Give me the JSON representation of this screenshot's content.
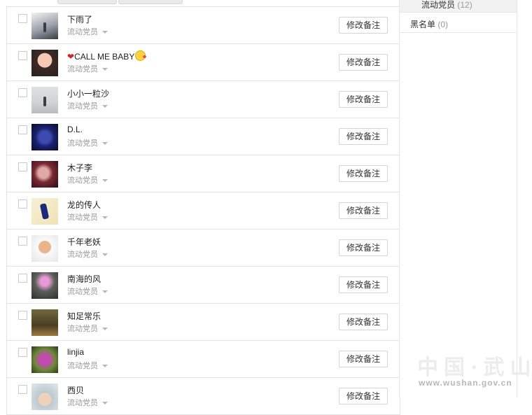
{
  "members": [
    {
      "name": "下雨了",
      "group": "流动党员",
      "action": "修改备注"
    },
    {
      "name_heart": "❤",
      "name": "CALL ME BABY",
      "name_emoji": "wink-kiss-emoji",
      "group": "流动党员",
      "action": "修改备注"
    },
    {
      "name": "小小一粒沙",
      "group": "流动党员",
      "action": "修改备注"
    },
    {
      "name": "D.L.",
      "group": "流动党员",
      "action": "修改备注"
    },
    {
      "name": "木子李",
      "group": "流动党员",
      "action": "修改备注"
    },
    {
      "name": "龙的传人",
      "group": "流动党员",
      "action": "修改备注"
    },
    {
      "name": "千年老妖",
      "group": "流动党员",
      "action": "修改备注"
    },
    {
      "name": "南海的风",
      "group": "流动党员",
      "action": "修改备注"
    },
    {
      "name": "知足常乐",
      "group": "流动党员",
      "action": "修改备注"
    },
    {
      "name": "linjia",
      "group": "流动党员",
      "action": "修改备注"
    },
    {
      "name": "西贝",
      "group": "流动党员",
      "action": "修改备注"
    }
  ],
  "sidebar": {
    "groups": [
      {
        "label": "流动党员",
        "count": "(12)"
      },
      {
        "label": "黑名单",
        "count": "(0)"
      }
    ]
  },
  "watermark": {
    "text": "中国·武山",
    "url": "www.wushan.gov.cn"
  },
  "colors": {
    "border": "#e3e3e3",
    "muted_text": "#999999",
    "heart": "#d0202a"
  }
}
